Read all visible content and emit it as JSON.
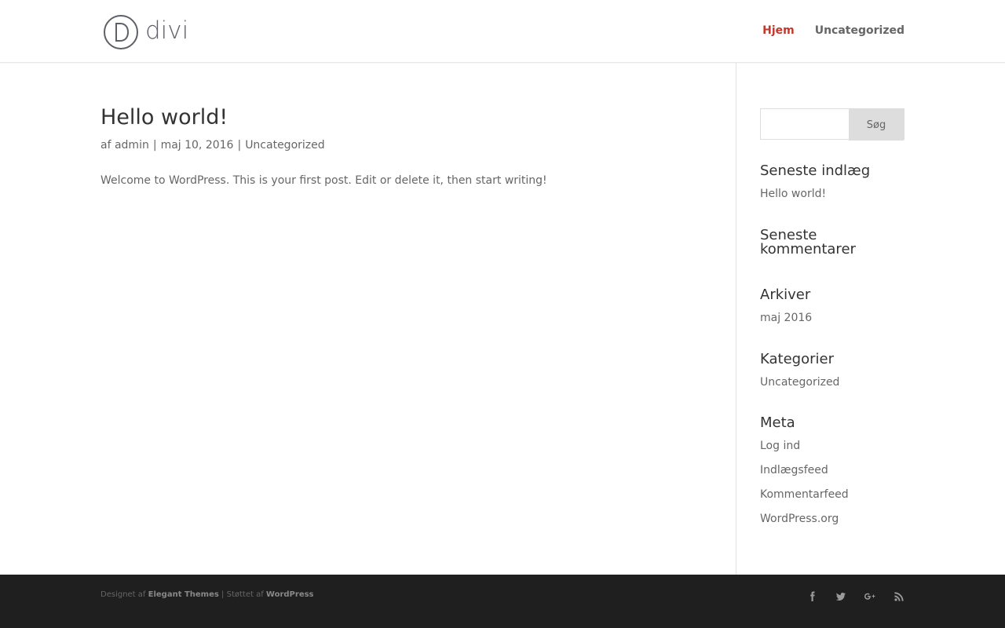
{
  "header": {
    "logo_text": "divi",
    "nav": [
      {
        "label": "Hjem",
        "active": true
      },
      {
        "label": "Uncategorized",
        "active": false
      }
    ],
    "accent_color": "#c0392b"
  },
  "post": {
    "title": "Hello world!",
    "meta": {
      "prefix": "af",
      "author": "admin",
      "separator": "|",
      "date": "maj 10, 2016",
      "category": "Uncategorized"
    },
    "body": "Welcome to WordPress. This is your first post. Edit or delete it, then start writing!"
  },
  "sidebar": {
    "search": {
      "input_value": "",
      "button_label": "Søg"
    },
    "recent_posts": {
      "title": "Seneste indlæg",
      "items": [
        "Hello world!"
      ]
    },
    "recent_comments": {
      "title_line1": "Seneste",
      "title_line2": "kommentarer"
    },
    "archives": {
      "title": "Arkiver",
      "items": [
        "maj 2016"
      ]
    },
    "categories": {
      "title": "Kategorier",
      "items": [
        "Uncategorized"
      ]
    },
    "meta": {
      "title": "Meta",
      "items": [
        "Log ind",
        "Indlægsfeed",
        "Kommentarfeed",
        "WordPress.org"
      ]
    }
  },
  "footer": {
    "designed_by_prefix": "Designet af",
    "designed_by": "Elegant Themes",
    "separator": "|",
    "powered_by_prefix": "Støttet af",
    "powered_by": "WordPress",
    "social_icons": [
      "facebook-icon",
      "twitter-icon",
      "google-plus-icon",
      "rss-icon"
    ]
  }
}
